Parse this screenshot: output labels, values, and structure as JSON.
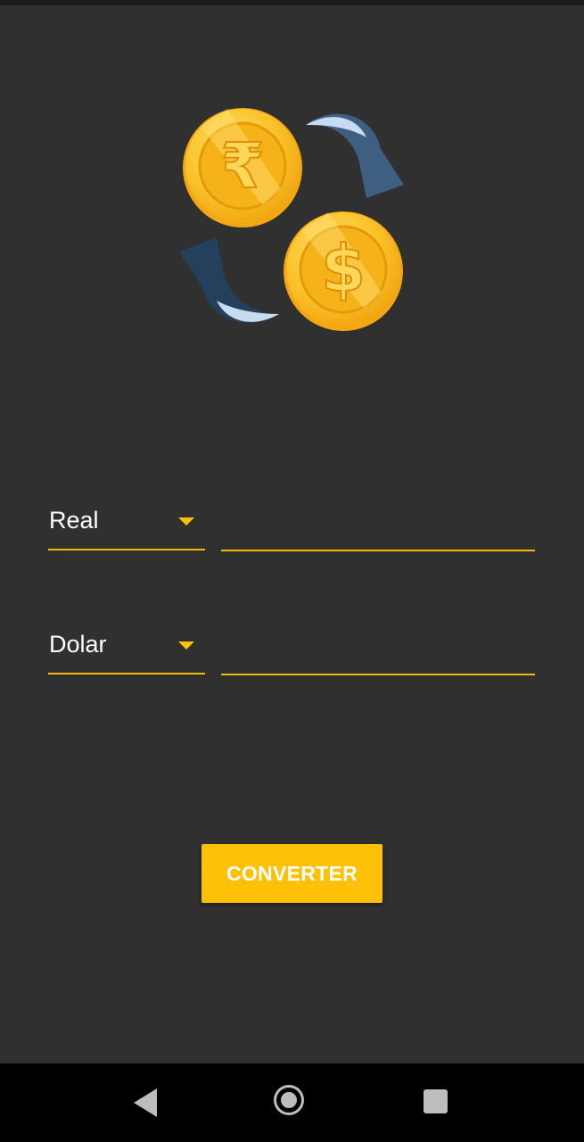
{
  "converter": {
    "from_currency": "Real",
    "to_currency": "Dolar",
    "from_value": "",
    "to_value": "",
    "button_label": "CONVERTER"
  },
  "logo": {
    "icons": [
      "rupee-coin-icon",
      "dollar-coin-icon",
      "exchange-arrows-icon"
    ]
  },
  "navigation": {
    "icons": [
      "back-icon",
      "home-icon",
      "recent-apps-icon"
    ]
  },
  "colors": {
    "background": "#303030",
    "accent": "#ffc107",
    "underline": "#f3b90c",
    "text": "#ffffff",
    "navbar": "#000000"
  }
}
